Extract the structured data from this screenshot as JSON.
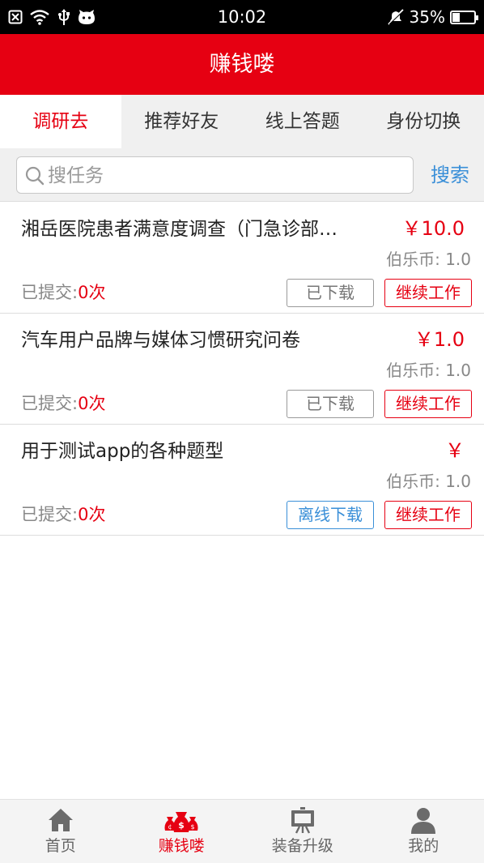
{
  "status_bar": {
    "time": "10:02",
    "battery": "35%",
    "battery_level": 0.35
  },
  "header": {
    "title": "赚钱喽"
  },
  "tabs": [
    {
      "label": "调研去",
      "active": true
    },
    {
      "label": "推荐好友",
      "active": false
    },
    {
      "label": "线上答题",
      "active": false
    },
    {
      "label": "身份切换",
      "active": false
    }
  ],
  "search": {
    "placeholder": "搜任务",
    "value": "",
    "button_label": "搜索"
  },
  "tasks": [
    {
      "title": "湘岳医院患者满意度调查（门急诊部…",
      "price": "￥10.0",
      "coin_label": "伯乐币:",
      "coin_value": "1.0",
      "submitted_label": "已提交:",
      "submitted_count": "0次",
      "download_label": "已下载",
      "continue_label": "继续工作"
    },
    {
      "title": "汽车用户品牌与媒体习惯研究问卷",
      "price": "￥1.0",
      "coin_label": "伯乐币:",
      "coin_value": "1.0",
      "submitted_label": "已提交:",
      "submitted_count": "0次",
      "download_label": "已下载",
      "continue_label": "继续工作"
    },
    {
      "title": "用于测试app的各种题型",
      "price": "￥",
      "coin_label": "伯乐币:",
      "coin_value": "1.0",
      "submitted_label": "已提交:",
      "submitted_count": "0次",
      "download_label": "离线下载",
      "continue_label": "继续工作"
    }
  ],
  "bottom_nav": [
    {
      "label": "首页",
      "icon": "home-icon",
      "active": false
    },
    {
      "label": "赚钱喽",
      "icon": "money-bags-icon",
      "active": true
    },
    {
      "label": "装备升级",
      "icon": "easel-icon",
      "active": false
    },
    {
      "label": "我的",
      "icon": "user-icon",
      "active": false
    }
  ],
  "colors": {
    "brand_red": "#e60012",
    "link_blue": "#3a8fd8"
  }
}
